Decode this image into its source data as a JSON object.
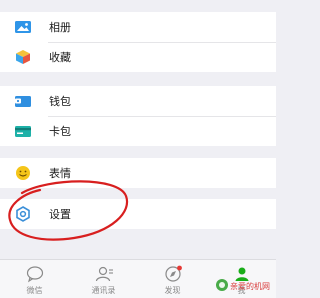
{
  "colors": {
    "background": "#efeff4",
    "row_background": "#ffffff",
    "annotation_red": "#d81f1f",
    "album_icon": "#2f95e8",
    "favorites_icon_blue": "#3aa5ea",
    "favorites_icon_yellow": "#f4c23a",
    "favorites_icon_red": "#e8563f",
    "wallet_icon": "#2f8fe0",
    "cards_icon": "#1db1a8",
    "stickers_icon": "#f5c519",
    "settings_icon": "#3b8fd8",
    "tab_label": "#8a8a8a",
    "discover_badge": "#e53935"
  },
  "menu": {
    "album": {
      "label": "相册",
      "icon": "album-icon"
    },
    "favorites": {
      "label": "收藏",
      "icon": "favorites-icon"
    },
    "wallet": {
      "label": "钱包",
      "icon": "wallet-icon"
    },
    "cards": {
      "label": "卡包",
      "icon": "cards-icon"
    },
    "stickers": {
      "label": "表情",
      "icon": "stickers-icon"
    },
    "settings": {
      "label": "设置",
      "icon": "settings-icon"
    }
  },
  "tabbar": {
    "tabs": [
      {
        "label": "微信",
        "icon": "chat-icon"
      },
      {
        "label": "通讯录",
        "icon": "contacts-icon"
      },
      {
        "label": "发现",
        "icon": "discover-compass-icon"
      },
      {
        "label": "我",
        "icon": "me-icon"
      }
    ]
  },
  "watermark": {
    "text": "亲爱的机网"
  }
}
